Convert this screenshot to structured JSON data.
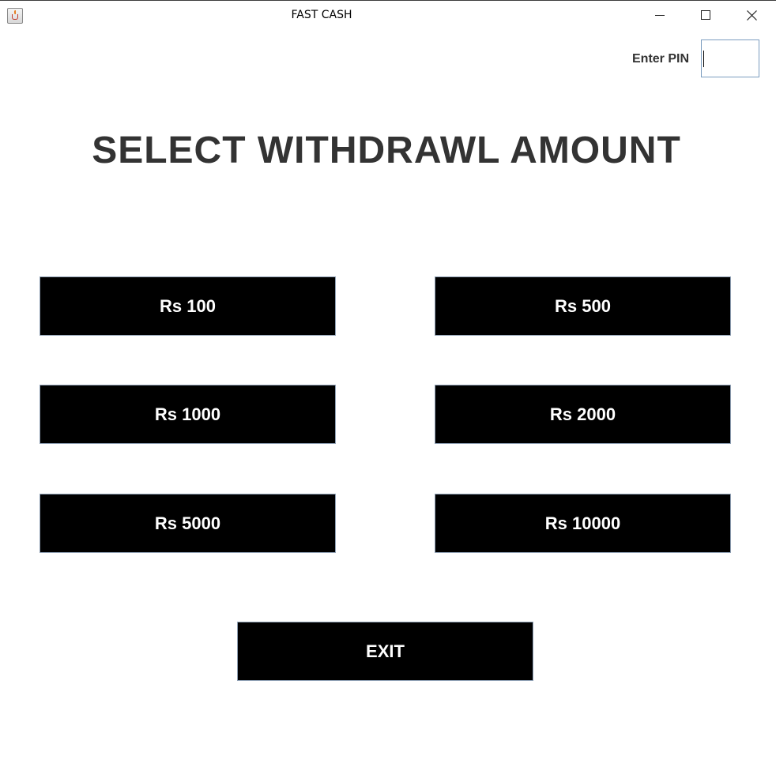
{
  "window": {
    "title": "FAST CASH",
    "icon": "java-app-icon",
    "controls": [
      "minimize-icon",
      "maximize-icon",
      "close-icon"
    ]
  },
  "pin": {
    "label": "Enter PIN",
    "value": ""
  },
  "heading": "SELECT WITHDRAWL AMOUNT",
  "amounts": [
    "Rs 100",
    "Rs 500",
    "Rs 1000",
    "Rs 2000",
    "Rs 5000",
    "Rs 10000"
  ],
  "exit_label": "EXIT",
  "colors": {
    "button_bg": "#000000",
    "button_text": "#ffffff",
    "heading_text": "#333333"
  }
}
